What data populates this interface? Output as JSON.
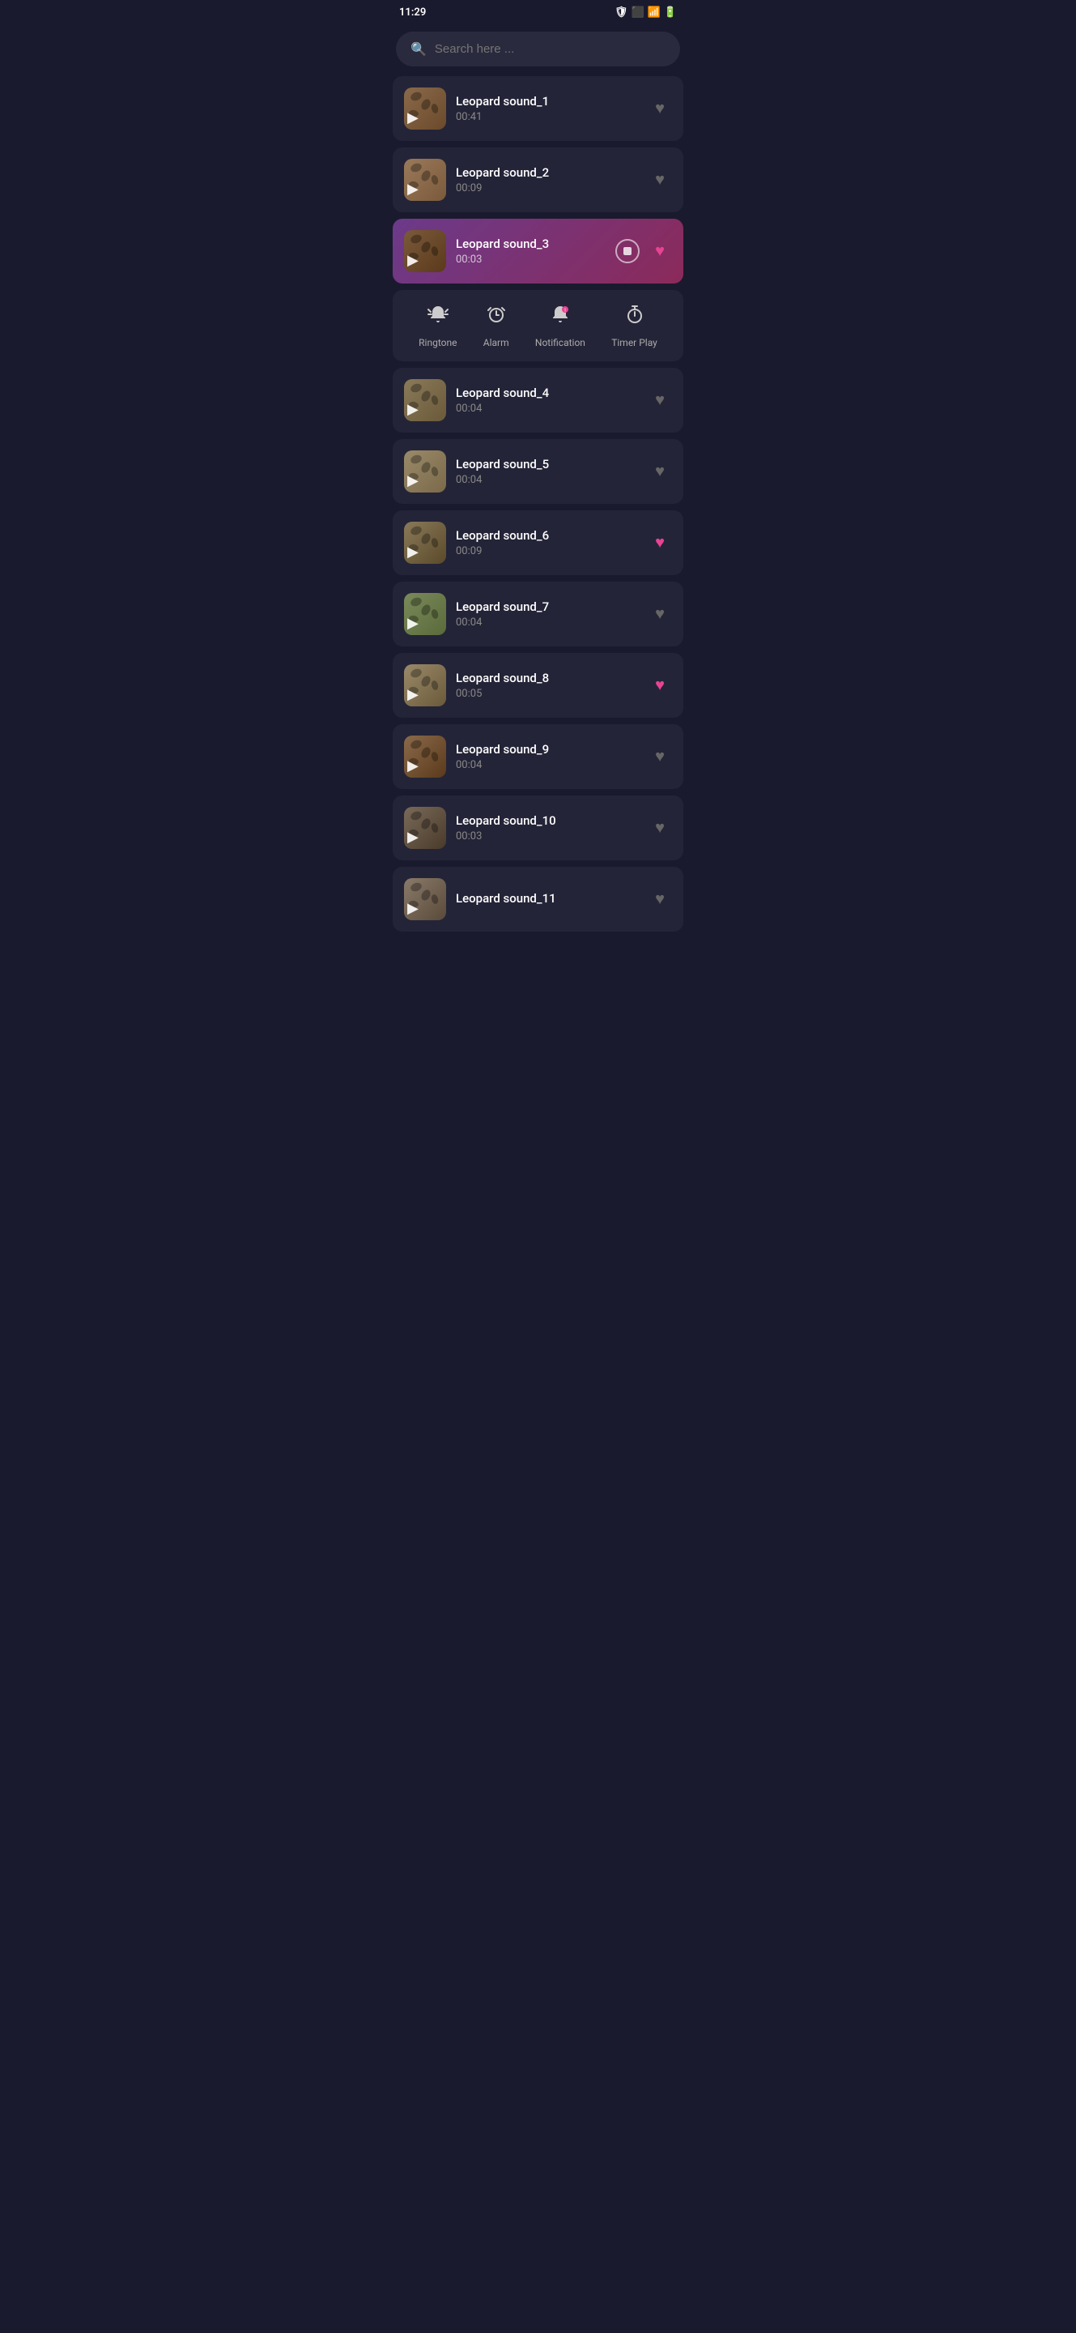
{
  "statusBar": {
    "time": "11:29",
    "icons": [
      "shield",
      "screen-rotation",
      "battery"
    ]
  },
  "search": {
    "placeholder": "Search here ..."
  },
  "sounds": [
    {
      "id": 1,
      "name": "Leopard sound_1",
      "duration": "00:41",
      "favorited": false,
      "active": false,
      "thumbClass": "thumb-1"
    },
    {
      "id": 2,
      "name": "Leopard sound_2",
      "duration": "00:09",
      "favorited": false,
      "active": false,
      "thumbClass": "thumb-2"
    },
    {
      "id": 3,
      "name": "Leopard sound_3",
      "duration": "00:03",
      "favorited": true,
      "active": true,
      "thumbClass": "thumb-3"
    },
    {
      "id": 4,
      "name": "Leopard sound_4",
      "duration": "00:04",
      "favorited": false,
      "active": false,
      "thumbClass": "thumb-4"
    },
    {
      "id": 5,
      "name": "Leopard sound_5",
      "duration": "00:04",
      "favorited": false,
      "active": false,
      "thumbClass": "thumb-5"
    },
    {
      "id": 6,
      "name": "Leopard sound_6",
      "duration": "00:09",
      "favorited": true,
      "active": false,
      "thumbClass": "thumb-6"
    },
    {
      "id": 7,
      "name": "Leopard sound_7",
      "duration": "00:04",
      "favorited": false,
      "active": false,
      "thumbClass": "thumb-7"
    },
    {
      "id": 8,
      "name": "Leopard sound_8",
      "duration": "00:05",
      "favorited": true,
      "active": false,
      "thumbClass": "thumb-8"
    },
    {
      "id": 9,
      "name": "Leopard sound_9",
      "duration": "00:04",
      "favorited": false,
      "active": false,
      "thumbClass": "thumb-9"
    },
    {
      "id": 10,
      "name": "Leopard sound_10",
      "duration": "00:03",
      "favorited": false,
      "active": false,
      "thumbClass": "thumb-10"
    },
    {
      "id": 11,
      "name": "Leopard sound_11",
      "duration": "",
      "favorited": false,
      "active": false,
      "thumbClass": "thumb-11"
    }
  ],
  "expandedOptions": [
    {
      "key": "ringtone",
      "icon": "🔔",
      "label": "Ringtone"
    },
    {
      "key": "alarm",
      "icon": "⏰",
      "label": "Alarm"
    },
    {
      "key": "notification",
      "icon": "🔔",
      "label": "Notification"
    },
    {
      "key": "timerPlay",
      "icon": "⏱",
      "label": "Timer Play"
    }
  ],
  "colors": {
    "bg": "#1a1a2e",
    "cardBg": "#242438",
    "activeBg1": "#6b3a8a",
    "activeBg2": "#8b2a5a",
    "heartFilled": "#e84393",
    "heartEmpty": "#666666"
  }
}
